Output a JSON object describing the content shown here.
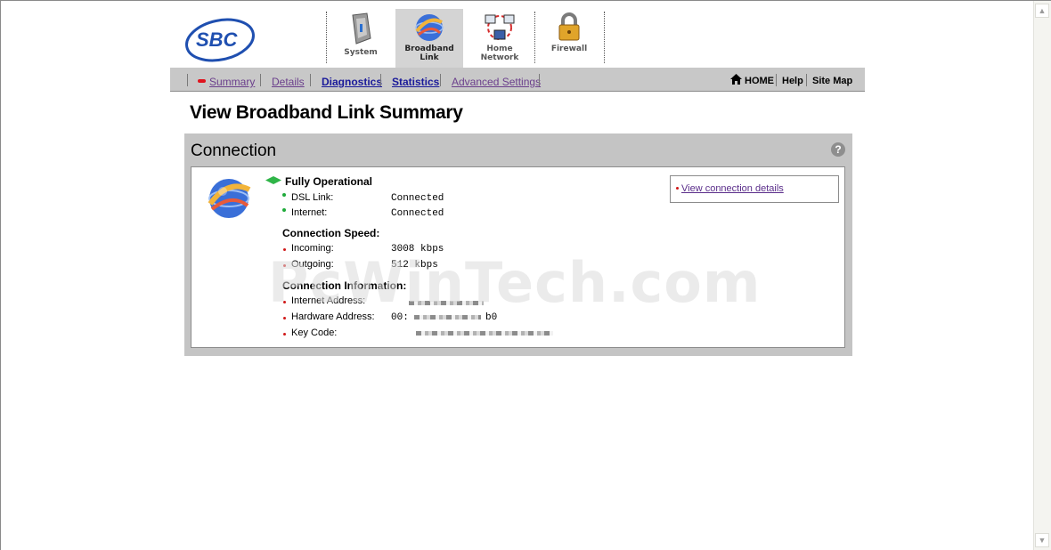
{
  "brand": {
    "logo_text": "SBC"
  },
  "nav": {
    "tabs": [
      {
        "label_line1": "System",
        "label_line2": ""
      },
      {
        "label_line1": "Broadband",
        "label_line2": "Link"
      },
      {
        "label_line1": "Home",
        "label_line2": "Network"
      },
      {
        "label_line1": "Firewall",
        "label_line2": ""
      }
    ],
    "active": "Broadband Link"
  },
  "subnav": {
    "items": [
      "Summary",
      "Details",
      "Diagnostics",
      "Statistics",
      "Advanced Settings"
    ],
    "active": "Summary",
    "right": {
      "home": "HOME",
      "help": "Help",
      "sitemap": "Site Map"
    }
  },
  "page": {
    "title": "View Broadband Link Summary"
  },
  "connection": {
    "title": "Connection",
    "help": "?",
    "status": "Fully Operational",
    "status_rows": [
      {
        "label": "DSL Link:",
        "value": "Connected"
      },
      {
        "label": "Internet:",
        "value": "Connected"
      }
    ],
    "speed_title": "Connection Speed:",
    "speed_rows": [
      {
        "label": "Incoming:",
        "value": "3008 kbps"
      },
      {
        "label": "Outgoing:",
        "value": "512 kbps"
      }
    ],
    "info_title": "Connection Information:",
    "info_rows": [
      {
        "label": "Internet Address:",
        "value": ""
      },
      {
        "label": "Hardware Address:",
        "value": "00:",
        "value_suffix": "b0"
      },
      {
        "label": "Key Code:",
        "value": ""
      }
    ],
    "details_link": "View connection details"
  },
  "watermark": "PcWinTech.com",
  "colors": {
    "accent_red": "#e0141e",
    "status_green": "#1faa3a",
    "panel_gray": "#c4c4c4",
    "link_visited": "#6b3f8c"
  }
}
